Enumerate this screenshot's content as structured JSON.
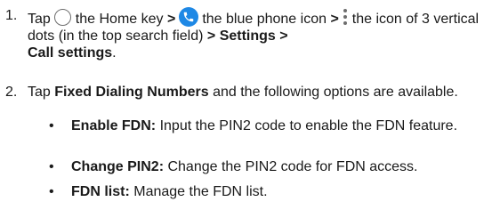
{
  "steps": [
    {
      "number": "1.",
      "tap": "Tap",
      "home_text": "the Home key",
      "sep1": ">",
      "phone_text": "the blue phone icon",
      "sep2": ">",
      "dots_text": "the icon of 3 vertical dots (in the top search field)",
      "sep3": ">",
      "settings": "Settings",
      "sep4": ">",
      "call_settings": "Call settings",
      "end": "."
    },
    {
      "number": "2.",
      "tap": "Tap",
      "fdn": "Fixed Dialing Numbers",
      "rest": "and the following options are available."
    }
  ],
  "options": [
    {
      "bullet": "•",
      "title": "Enable FDN:",
      "desc": "Input the PIN2 code to enable the FDN feature."
    },
    {
      "bullet": "•",
      "title": "Change PIN2:",
      "desc": "Change the PIN2 code for FDN access."
    },
    {
      "bullet": "•",
      "title": "FDN list:",
      "desc": "Manage the FDN list."
    }
  ],
  "icons": {
    "home": "home-circle-icon",
    "phone": "phone-icon",
    "dots": "more-vertical-icon",
    "phone_color": "#1e88e5",
    "outline_color": "#6d6d6d"
  }
}
